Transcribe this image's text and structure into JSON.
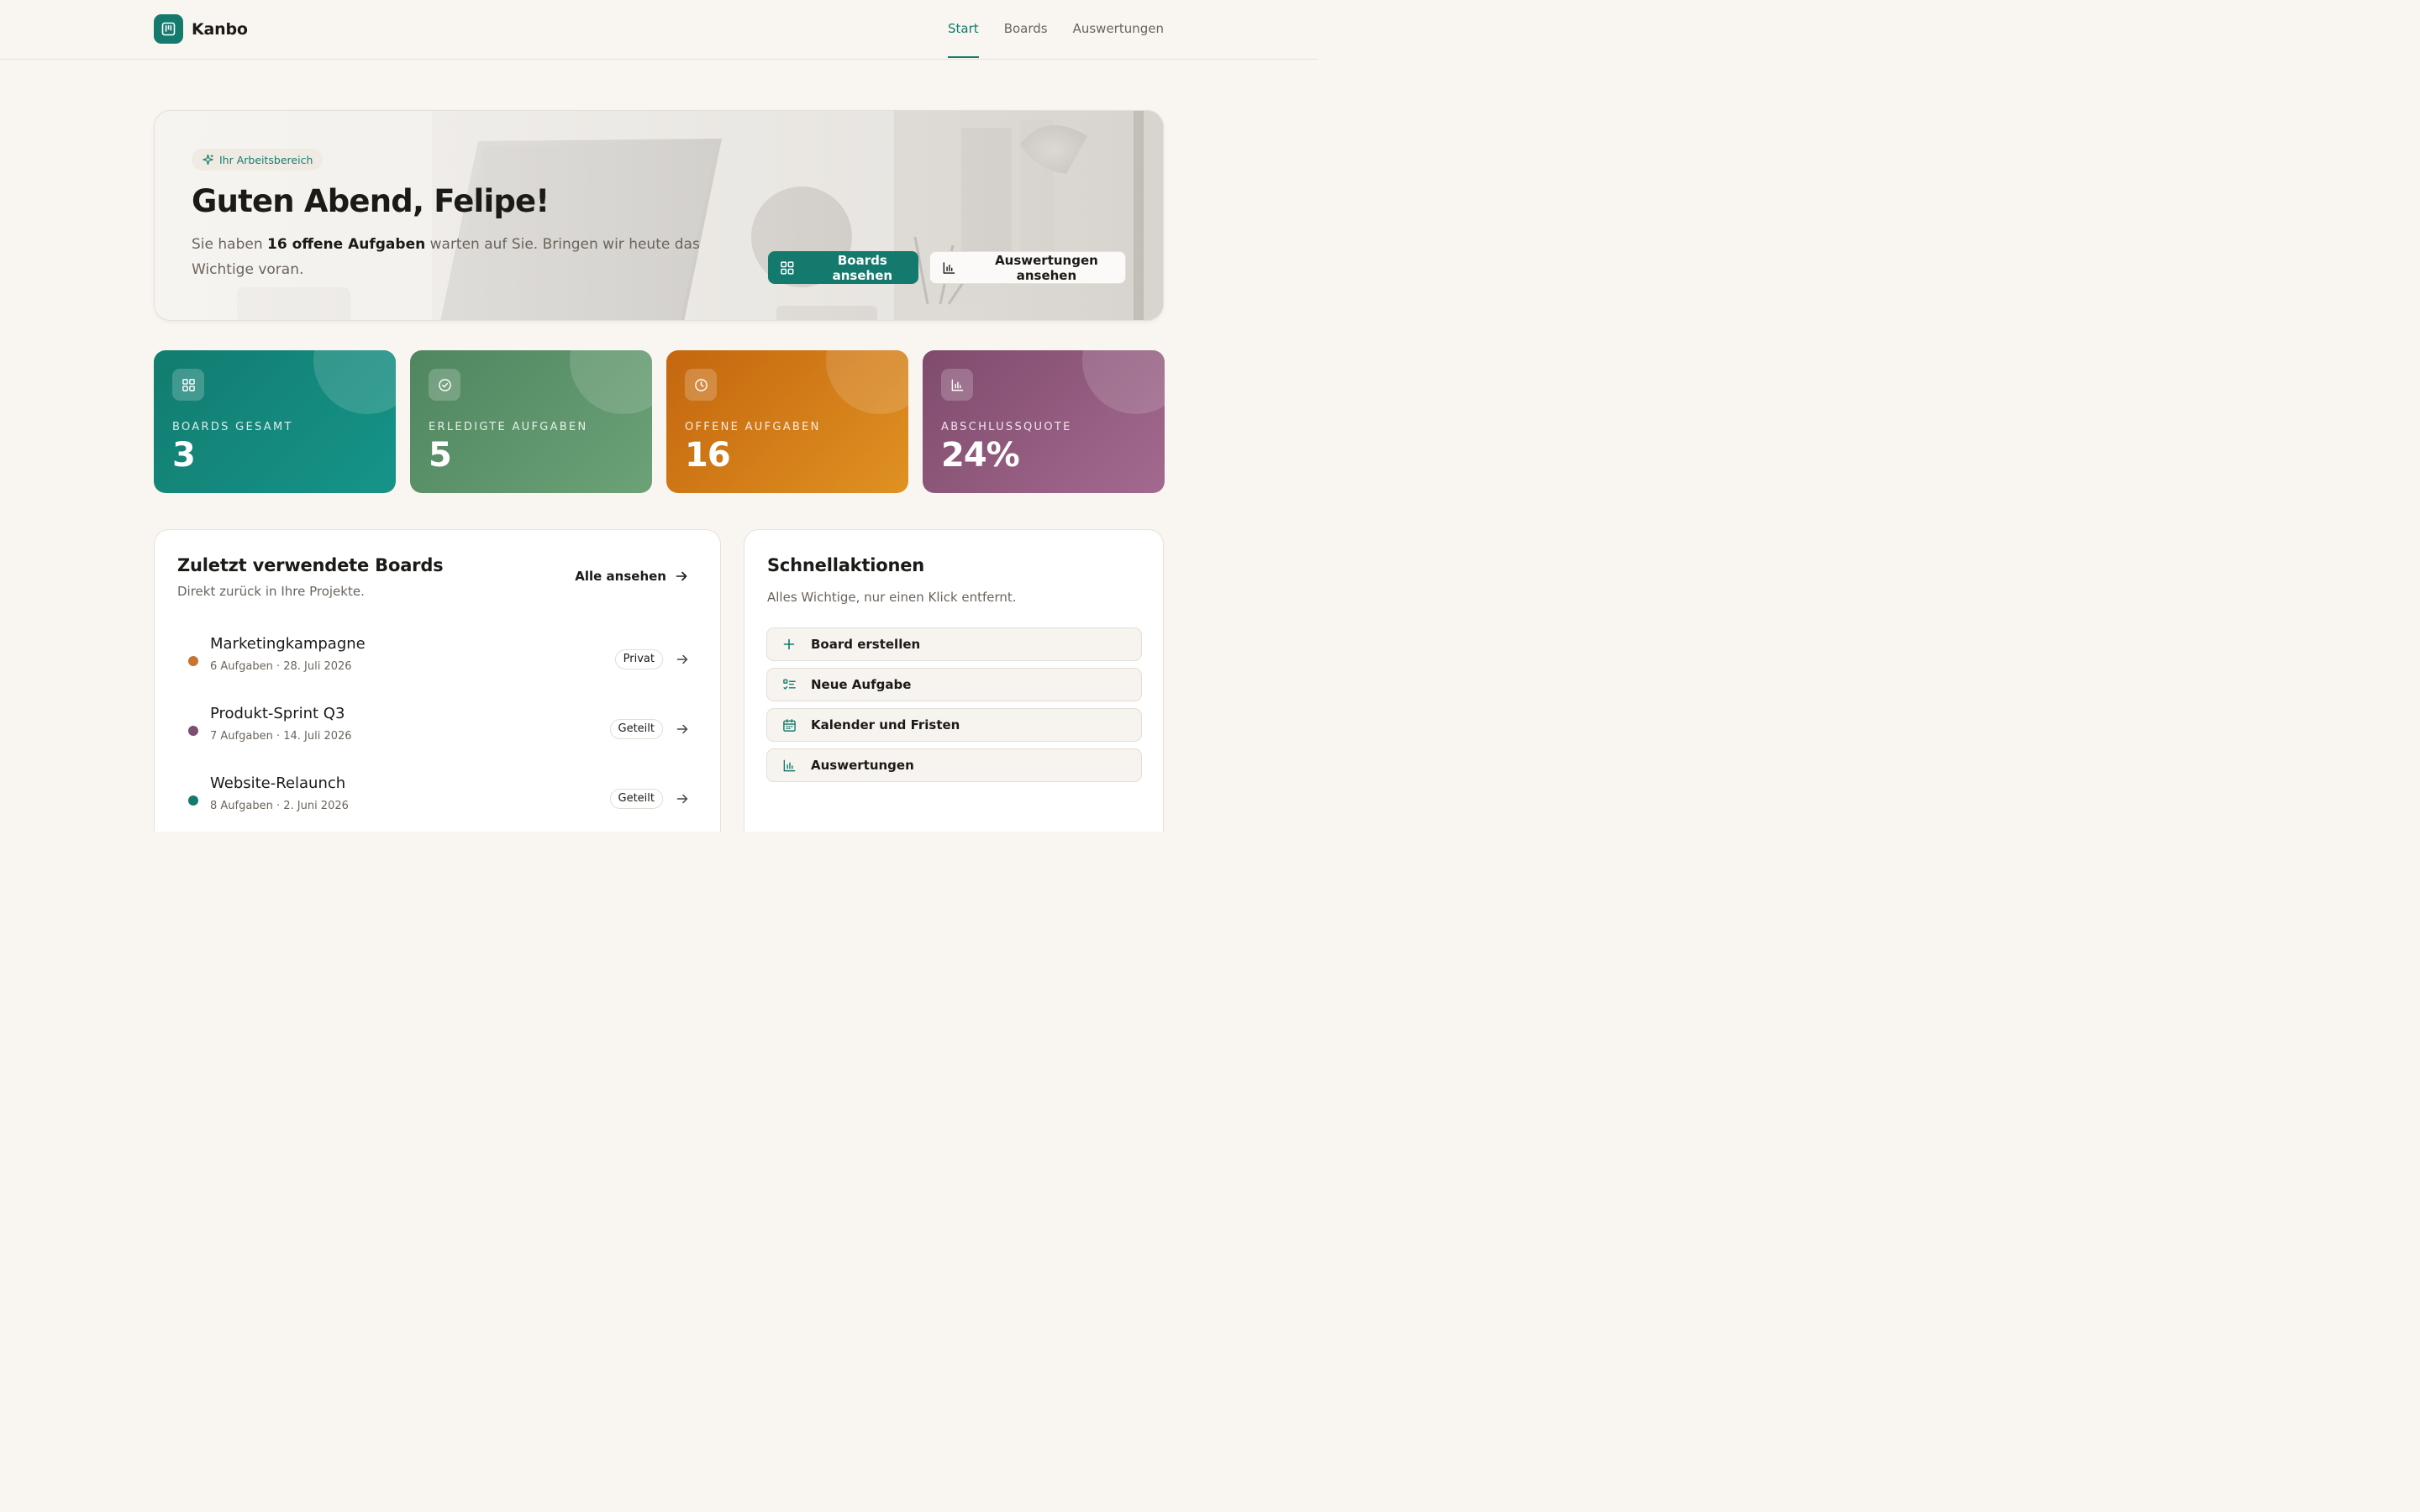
{
  "app": {
    "name": "Kanbo"
  },
  "nav": [
    {
      "label": "Start",
      "active": true
    },
    {
      "label": "Boards",
      "active": false
    },
    {
      "label": "Auswertungen",
      "active": false
    }
  ],
  "hero": {
    "chip": "Ihr Arbeitsbereich",
    "title": "Guten Abend, Felipe!",
    "text_before": "Sie haben ",
    "text_bold": "16 offene Aufgaben",
    "text_after": " warten auf Sie. Bringen wir heute das Wichtige voran.",
    "primary_button": "Boards ansehen",
    "secondary_button": "Auswertungen ansehen"
  },
  "stats": [
    {
      "label": "BOARDS GESAMT",
      "value": "3",
      "icon": "grid-icon",
      "color_from": "#127c70",
      "color_to": "#169488"
    },
    {
      "label": "ERLEDIGTE AUFGABEN",
      "value": "5",
      "icon": "check-circle-icon",
      "color_from": "#4f8660",
      "color_to": "#6da277"
    },
    {
      "label": "OFFENE AUFGABEN",
      "value": "16",
      "icon": "clock-icon",
      "color_from": "#c4660f",
      "color_to": "#e09222"
    },
    {
      "label": "ABSCHLUSSQUOTE",
      "value": "24%",
      "icon": "bar-chart-icon",
      "color_from": "#7f4b6d",
      "color_to": "#a36a8f"
    }
  ],
  "recent": {
    "title": "Zuletzt verwendete Boards",
    "subtitle": "Direkt zurück in Ihre Projekte.",
    "all_link": "Alle ansehen",
    "boards": [
      {
        "name": "Marketingkampagne",
        "meta": "6 Aufgaben · 28. Juli 2026",
        "badge": "Privat",
        "dot_color": "#c47433"
      },
      {
        "name": "Produkt-Sprint Q3",
        "meta": "7 Aufgaben · 14. Juli 2026",
        "badge": "Geteilt",
        "dot_color": "#7e4e6f"
      },
      {
        "name": "Website-Relaunch",
        "meta": "8 Aufgaben · 2. Juni 2026",
        "badge": "Geteilt",
        "dot_color": "#157a6e"
      }
    ]
  },
  "quick": {
    "title": "Schnellaktionen",
    "subtitle": "Alles Wichtige, nur einen Klick entfernt.",
    "actions": [
      {
        "label": "Board erstellen",
        "icon": "plus-icon"
      },
      {
        "label": "Neue Aufgabe",
        "icon": "checklist-icon"
      },
      {
        "label": "Kalender und Fristen",
        "icon": "calendar-icon"
      },
      {
        "label": "Auswertungen",
        "icon": "bar-chart-icon"
      }
    ]
  },
  "colors": {
    "accent": "#157a6e",
    "background": "#f9f6f1"
  }
}
